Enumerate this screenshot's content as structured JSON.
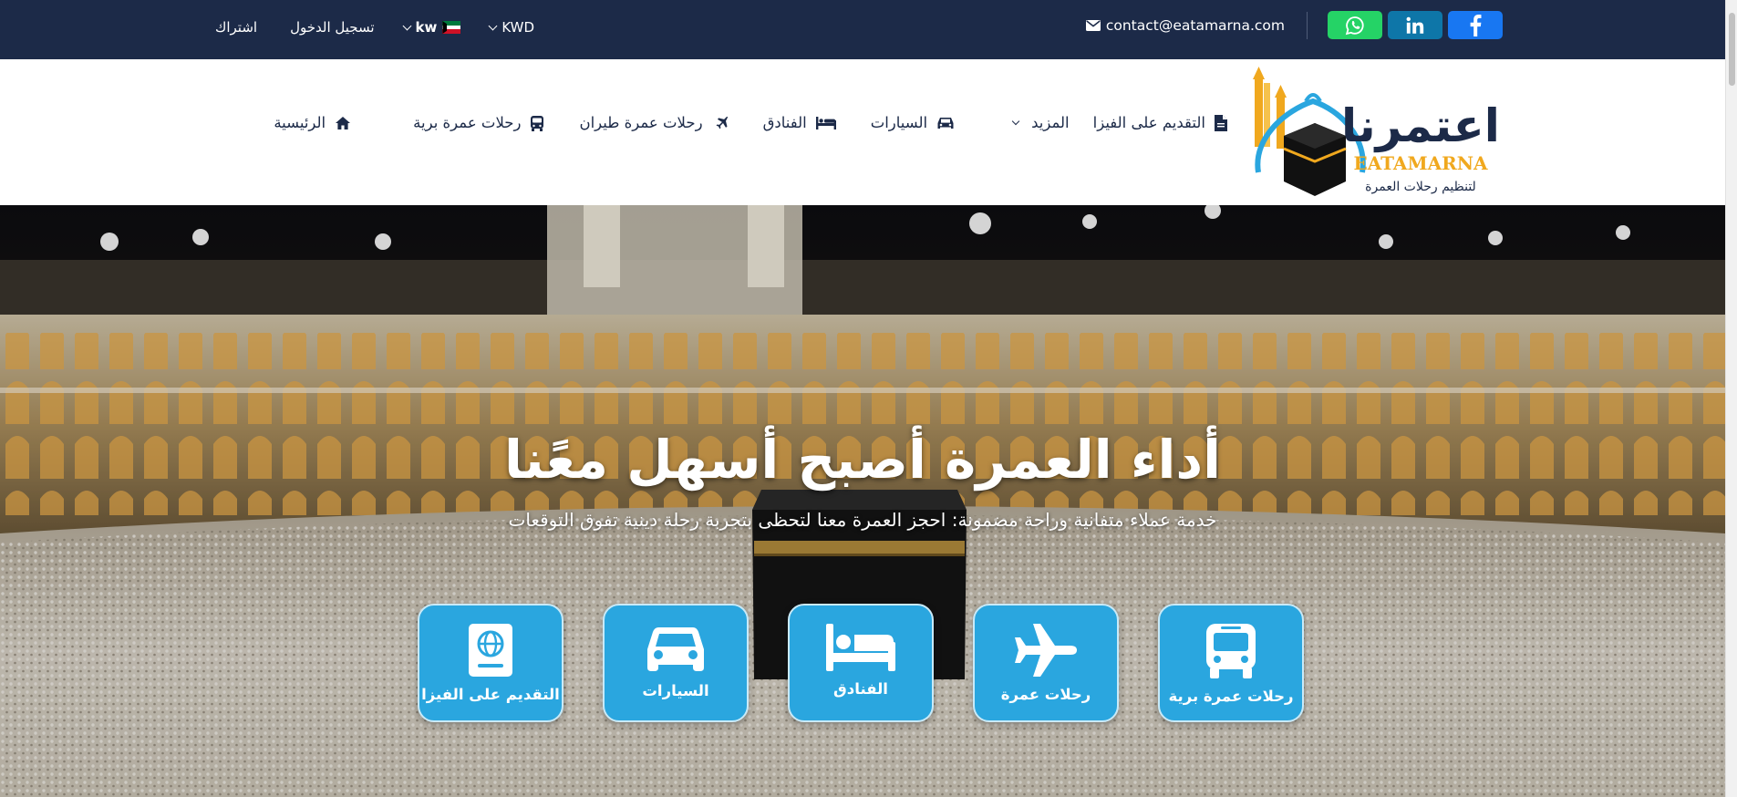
{
  "topbar": {
    "signup_label": "اشتراك",
    "login_label": "تسجيل الدخول",
    "language_label": "kw",
    "currency_label": "KWD",
    "email": "contact@eatamarna.com",
    "social": [
      "whatsapp-icon",
      "linkedin-icon",
      "facebook-icon"
    ]
  },
  "logo": {
    "arabic_name": "اعتمرنا",
    "latin_name": "EATAMARNA",
    "tagline": "لتنظيم رحلات العمرة"
  },
  "nav": {
    "items": [
      {
        "label": "الرئيسية",
        "icon": "home-icon"
      },
      {
        "label": "رحلات عمرة برية",
        "icon": "bus-icon"
      },
      {
        "label": "رحلات عمرة طيران",
        "icon": "plane-icon"
      },
      {
        "label": "الفنادق",
        "icon": "bed-icon"
      },
      {
        "label": "السيارات",
        "icon": "car-icon"
      },
      {
        "label": "المزيد",
        "icon": "chevron-down-icon"
      },
      {
        "label": "التقديم على الفيزا",
        "icon": "file-icon"
      }
    ]
  },
  "hero": {
    "title": "أداء العمرة أصبح أسهل معًنا",
    "subtitle": "خدمة عملاء متفانية وراحة مضمونة: احجز العمرة معنا لتحظى بتجربة رحلة دينية تفوق التوقعات",
    "cards": [
      {
        "label": "التقديم على الفيزا",
        "icon": "passport-icon"
      },
      {
        "label": "السيارات",
        "icon": "car-icon"
      },
      {
        "label": "الفنادق",
        "icon": "bed-icon"
      },
      {
        "label": "رحلات عمرة",
        "icon": "plane-icon"
      },
      {
        "label": "رحلات عمرة برية",
        "icon": "bus-icon"
      }
    ]
  },
  "colors": {
    "topbar_bg": "#1c2a48",
    "card_bg": "#2aa6df",
    "whatsapp": "#25d366",
    "linkedin": "#0e76a8",
    "facebook": "#1877f2",
    "logo_gold": "#f0a81e",
    "logo_blue": "#2aa6df"
  }
}
